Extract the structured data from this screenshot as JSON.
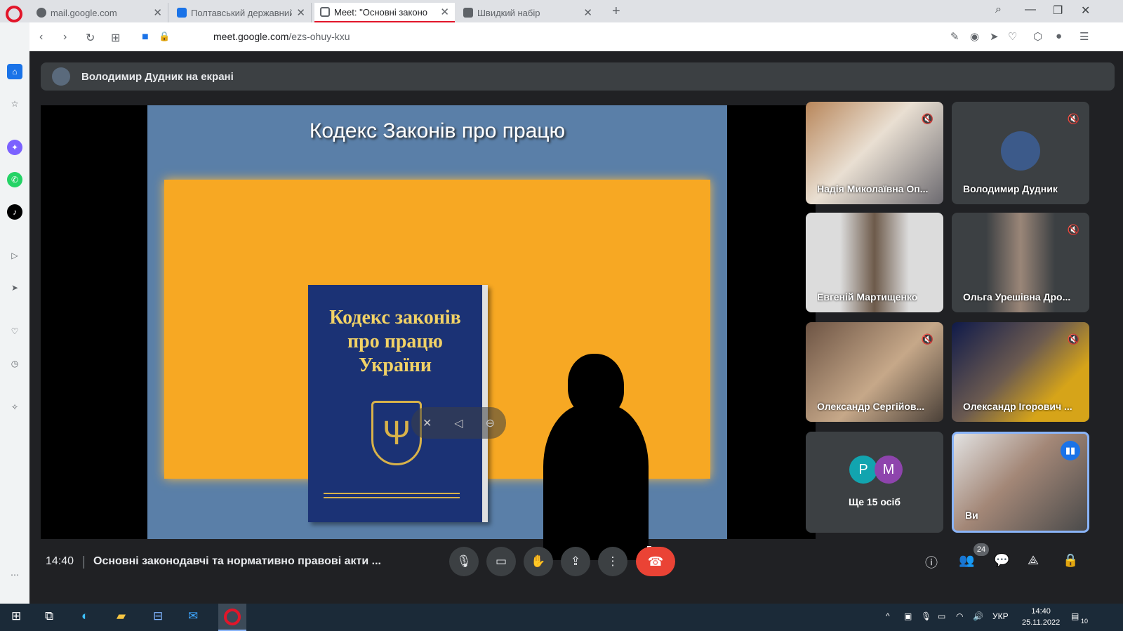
{
  "browser": {
    "tabs": [
      {
        "label": "mail.google.com",
        "close": "✕"
      },
      {
        "label": "Полтавський державний а",
        "close": "✕"
      },
      {
        "label": "Meet: \"Основні законо",
        "close": "✕"
      },
      {
        "label": "Швидкий набір",
        "close": "✕"
      }
    ],
    "new_tab": "+",
    "url_domain": "meet.google.com",
    "url_path": "/ezs-ohuy-kxu"
  },
  "meet": {
    "presenter_banner": "Володимир Дудник на екрані",
    "slide": {
      "title": "Кодекс Законів про працю",
      "book_line1": "Кодекс законів",
      "book_line2": "про працю",
      "book_line3": "України"
    },
    "participants": [
      {
        "name": "Надія Миколаївна Оп...",
        "muted": true
      },
      {
        "name": "Володимир Дудник",
        "muted": true
      },
      {
        "name": "Евгеній Мартищенко",
        "muted": false
      },
      {
        "name": "Ольга Урешівна Дро...",
        "muted": true
      },
      {
        "name": "Олександр Сергійов...",
        "muted": true
      },
      {
        "name": "Олександр Ігорович ...",
        "muted": true
      },
      {
        "name": "Ви",
        "muted": false
      }
    ],
    "more": {
      "letters": [
        "P",
        "M"
      ],
      "letter_colors": [
        "#12a4af",
        "#8e44ad"
      ],
      "text": "Ще 15 осіб"
    },
    "time": "14:40",
    "meeting_title": "Основні законодавчі та нормативно правові акти ...",
    "participant_count": "24"
  },
  "taskbar": {
    "lang": "УКР",
    "clock_time": "14:40",
    "clock_date": "25.11.2022",
    "notifications": "10"
  },
  "colors": {
    "opera_red": "#e2162a",
    "end_call": "#ea4335",
    "meet_bg": "#202124",
    "speaking_blue": "#1a73e8"
  }
}
